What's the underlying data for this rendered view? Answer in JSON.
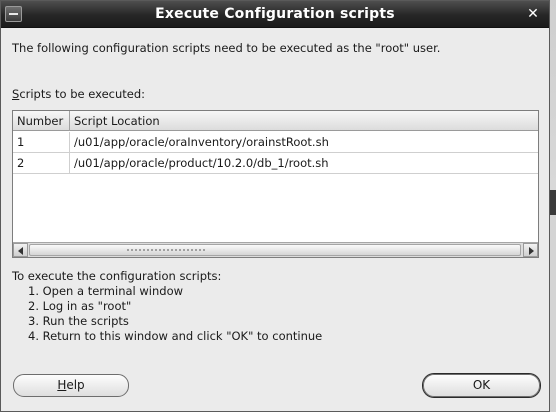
{
  "window": {
    "title": "Execute Configuration scripts",
    "close_glyph": "✕",
    "menu_icon": "window-menu-icon"
  },
  "intro": "The following configuration scripts need to be executed as the \"root\" user.",
  "scripts_label": {
    "mnemonic": "S",
    "rest": "cripts to be executed:"
  },
  "table": {
    "columns": [
      "Number",
      "Script Location"
    ],
    "rows": [
      {
        "number": "1",
        "location": "/u01/app/oracle/oraInventory/orainstRoot.sh"
      },
      {
        "number": "2",
        "location": "/u01/app/oracle/product/10.2.0/db_1/root.sh"
      }
    ]
  },
  "instructions": {
    "title": "To execute the configuration scripts:",
    "steps": [
      "1. Open a terminal window",
      "2. Log in as \"root\"",
      "3. Run the scripts",
      "4. Return to this window and click \"OK\" to continue"
    ]
  },
  "buttons": {
    "help": {
      "mnemonic": "H",
      "rest": "elp"
    },
    "ok": "OK"
  }
}
